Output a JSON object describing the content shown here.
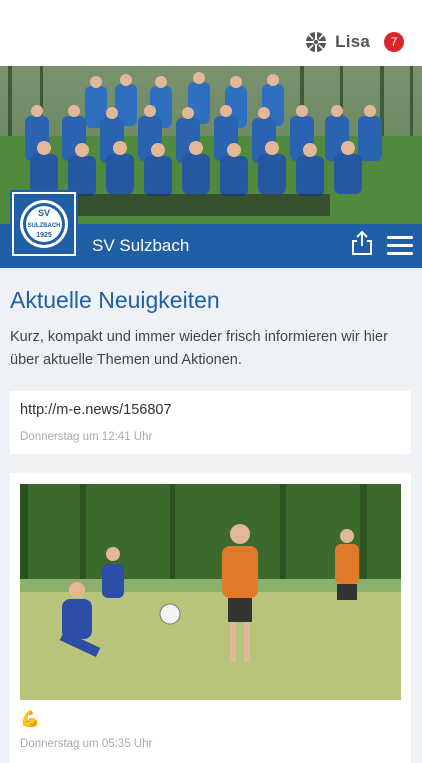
{
  "header": {
    "user_name": "Lisa",
    "notification_count": "7",
    "icons": {
      "user": "football-icon"
    }
  },
  "club": {
    "name": "SV Sulzbach",
    "crest_text_top": "SV",
    "crest_text_middle": "SULZBACH",
    "crest_year": "1925"
  },
  "main": {
    "section_title": "Aktuelle Neuigkeiten",
    "intro": "Kurz, kompakt und immer wieder frisch informieren wir hier über aktuelle Themen und Aktionen.",
    "posts": [
      {
        "link": "http://m-e.news/156807",
        "time": "Donnerstag um 12:41 Uhr"
      },
      {
        "emoji": "💪",
        "time": "Donnerstag um 05:35 Uhr"
      }
    ]
  },
  "colors": {
    "brand_blue": "#1e5fa5",
    "badge_red": "#d8262b",
    "background": "#eef2f7"
  }
}
